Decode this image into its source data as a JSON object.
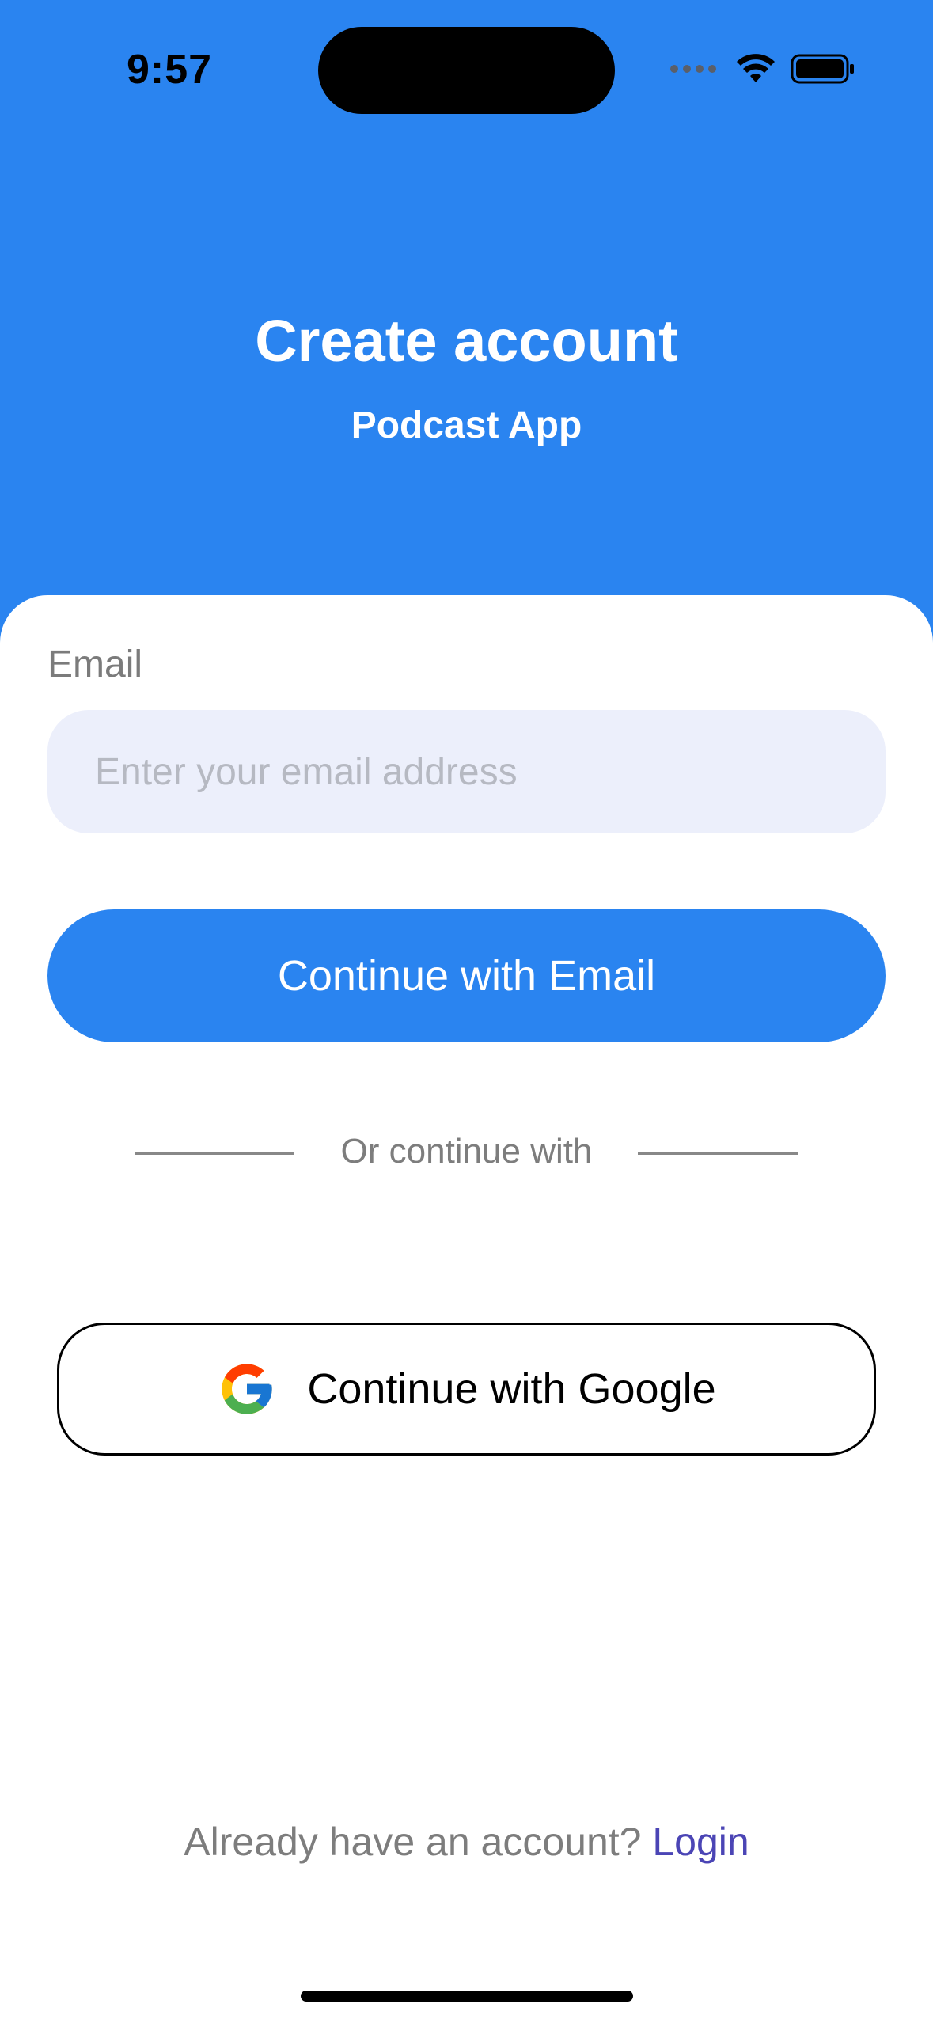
{
  "status_bar": {
    "time": "9:57"
  },
  "header": {
    "title": "Create account",
    "subtitle": "Podcast App",
    "background_color": "#2A84F0"
  },
  "form": {
    "email_label": "Email",
    "email_placeholder": "Enter your email address",
    "email_value": "",
    "continue_email_label": "Continue with Email",
    "divider_text": "Or continue with",
    "google_label": "Continue with Google",
    "google_icon": "google-g-logo"
  },
  "footer": {
    "prompt": "Already have an account?",
    "login_label": "Login",
    "login_color": "#4B45B5"
  },
  "colors": {
    "accent": "#2A84F0",
    "input_background": "#ECEFFB"
  }
}
